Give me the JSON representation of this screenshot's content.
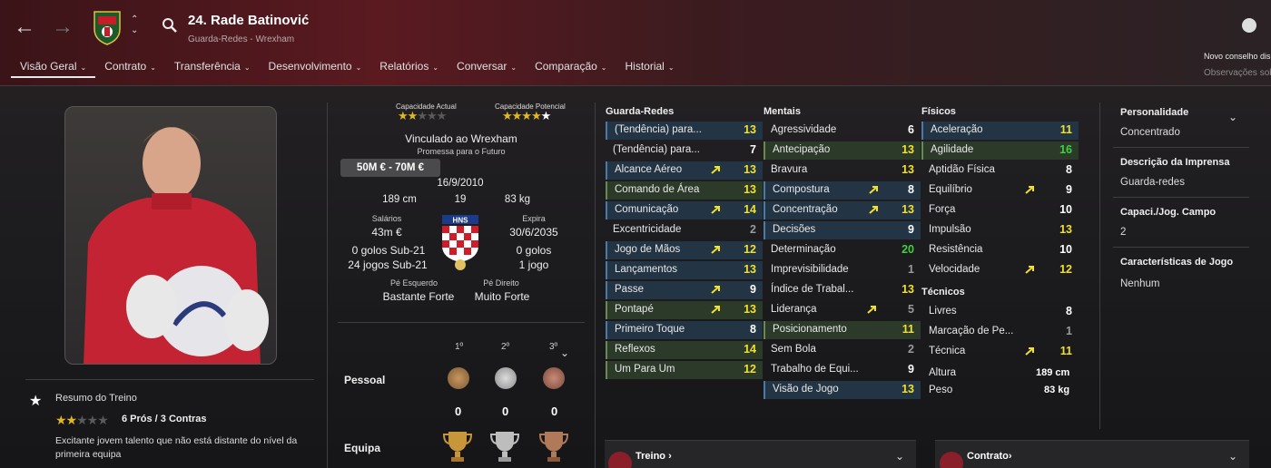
{
  "header": {
    "name": "24. Rade Batinović",
    "subtitle": "Guarda-Redes - Wrexham",
    "new_advice": "Novo conselho disp",
    "observations": "Observações sobre"
  },
  "tabs": [
    "Visão Geral",
    "Contrato",
    "Transferência",
    "Desenvolvimento",
    "Relatórios",
    "Conversar",
    "Comparação",
    "Historial"
  ],
  "training": {
    "title": "Resumo do Treino",
    "pros_cons": "6 Prós / 3 Contras",
    "stars": 2,
    "description": "Excitante jovem talento que não está distante do nível da primeira equipa"
  },
  "ability": {
    "current_label": "Capacidade Actual",
    "potential_label": "Capacidade Potencial",
    "current_stars": 2,
    "potential_stars": 4.5
  },
  "profile": {
    "contract": "Vinculado ao Wrexham",
    "promise": "Promessa para o Futuro",
    "value": "50M € - 70M €",
    "dob": "16/9/2010",
    "height": "189 cm",
    "age": "19",
    "weight": "83 kg",
    "wage_label": "Salários",
    "wage": "43m €",
    "expires_label": "Expira",
    "expires": "30/6/2035",
    "goals_u21": "0 golos Sub-21",
    "games_u21": "24 jogos Sub-21",
    "goals": "0 golos",
    "games": "1 jogo",
    "left_foot_label": "Pé Esquerdo",
    "left_foot": "Bastante Forte",
    "right_foot_label": "Pé Direito",
    "right_foot": "Muito Forte"
  },
  "trophies": {
    "col1": "1º",
    "col2": "2º",
    "col3": "3º",
    "personal_label": "Pessoal",
    "team_label": "Equipa",
    "personal": [
      "0",
      "0",
      "0"
    ]
  },
  "goalkeeping": {
    "title": "Guarda-Redes",
    "items": [
      {
        "name": "(Tendência) para...",
        "value": "13",
        "tone": "b",
        "arrow": false,
        "col": "y"
      },
      {
        "name": "(Tendência) para...",
        "value": "7",
        "tone": "n",
        "arrow": false,
        "col": "wt"
      },
      {
        "name": "Alcance Aéreo",
        "value": "13",
        "tone": "b",
        "arrow": true,
        "col": "y"
      },
      {
        "name": "Comando de Área",
        "value": "13",
        "tone": "g",
        "arrow": false,
        "col": "y"
      },
      {
        "name": "Comunicação",
        "value": "14",
        "tone": "b",
        "arrow": true,
        "col": "y"
      },
      {
        "name": "Excentricidade",
        "value": "2",
        "tone": "n",
        "arrow": false,
        "col": "dim"
      },
      {
        "name": "Jogo de Mãos",
        "value": "12",
        "tone": "b",
        "arrow": true,
        "col": "y"
      },
      {
        "name": "Lançamentos",
        "value": "13",
        "tone": "b",
        "arrow": false,
        "col": "y"
      },
      {
        "name": "Passe",
        "value": "9",
        "tone": "b",
        "arrow": true,
        "col": "wt"
      },
      {
        "name": "Pontapé",
        "value": "13",
        "tone": "g",
        "arrow": true,
        "col": "y"
      },
      {
        "name": "Primeiro Toque",
        "value": "8",
        "tone": "b",
        "arrow": false,
        "col": "wt"
      },
      {
        "name": "Reflexos",
        "value": "14",
        "tone": "g",
        "arrow": false,
        "col": "y"
      },
      {
        "name": "Um Para Um",
        "value": "12",
        "tone": "g",
        "arrow": false,
        "col": "y"
      }
    ]
  },
  "mental": {
    "title": "Mentais",
    "items": [
      {
        "name": "Agressividade",
        "value": "6",
        "tone": "n",
        "arrow": false,
        "col": "wt"
      },
      {
        "name": "Antecipação",
        "value": "13",
        "tone": "g",
        "arrow": false,
        "col": "y"
      },
      {
        "name": "Bravura",
        "value": "13",
        "tone": "n",
        "arrow": false,
        "col": "y"
      },
      {
        "name": "Compostura",
        "value": "8",
        "tone": "b",
        "arrow": true,
        "col": "wt"
      },
      {
        "name": "Concentração",
        "value": "13",
        "tone": "b",
        "arrow": true,
        "col": "y"
      },
      {
        "name": "Decisões",
        "value": "9",
        "tone": "b",
        "arrow": false,
        "col": "wt"
      },
      {
        "name": "Determinação",
        "value": "20",
        "tone": "n",
        "arrow": false,
        "col": "gr"
      },
      {
        "name": "Imprevisibilidade",
        "value": "1",
        "tone": "n",
        "arrow": false,
        "col": "dim"
      },
      {
        "name": "Índice de Trabal...",
        "value": "13",
        "tone": "n",
        "arrow": false,
        "col": "y"
      },
      {
        "name": "Liderança",
        "value": "5",
        "tone": "n",
        "arrow": true,
        "col": "dim"
      },
      {
        "name": "Posicionamento",
        "value": "11",
        "tone": "g",
        "arrow": false,
        "col": "y"
      },
      {
        "name": "Sem Bola",
        "value": "2",
        "tone": "n",
        "arrow": false,
        "col": "dim"
      },
      {
        "name": "Trabalho de Equi...",
        "value": "9",
        "tone": "n",
        "arrow": false,
        "col": "wt"
      },
      {
        "name": "Visão de Jogo",
        "value": "13",
        "tone": "b",
        "arrow": false,
        "col": "y"
      }
    ]
  },
  "physical": {
    "title": "Físicos",
    "items": [
      {
        "name": "Aceleração",
        "value": "11",
        "tone": "b",
        "arrow": false,
        "col": "y"
      },
      {
        "name": "Agilidade",
        "value": "16",
        "tone": "g",
        "arrow": false,
        "col": "gr"
      },
      {
        "name": "Aptidão Física",
        "value": "8",
        "tone": "n",
        "arrow": false,
        "col": "wt"
      },
      {
        "name": "Equilíbrio",
        "value": "9",
        "tone": "n",
        "arrow": true,
        "col": "wt"
      },
      {
        "name": "Força",
        "value": "10",
        "tone": "n",
        "arrow": false,
        "col": "wt"
      },
      {
        "name": "Impulsão",
        "value": "13",
        "tone": "n",
        "arrow": false,
        "col": "y"
      },
      {
        "name": "Resistência",
        "value": "10",
        "tone": "n",
        "arrow": false,
        "col": "wt"
      },
      {
        "name": "Velocidade",
        "value": "12",
        "tone": "n",
        "arrow": true,
        "col": "y"
      }
    ]
  },
  "technical": {
    "title": "Técnicos",
    "items": [
      {
        "name": "Livres",
        "value": "8",
        "tone": "n",
        "arrow": false,
        "col": "wt"
      },
      {
        "name": "Marcação de Pe...",
        "value": "1",
        "tone": "n",
        "arrow": false,
        "col": "dim"
      },
      {
        "name": "Técnica",
        "value": "11",
        "tone": "n",
        "arrow": true,
        "col": "y"
      }
    ]
  },
  "measures": {
    "height_label": "Altura",
    "height": "189 cm",
    "weight_label": "Peso",
    "weight": "83 kg"
  },
  "right": {
    "personality_label": "Personalidade",
    "personality": "Concentrado",
    "press_label": "Descrição da Imprensa",
    "press": "Guarda-redes",
    "field_label": "Capaci./Jog. Campo",
    "field": "2",
    "traits_label": "Características de Jogo",
    "traits": "Nenhum"
  },
  "bottom": {
    "training": "Treino",
    "contract": "Contrato"
  }
}
